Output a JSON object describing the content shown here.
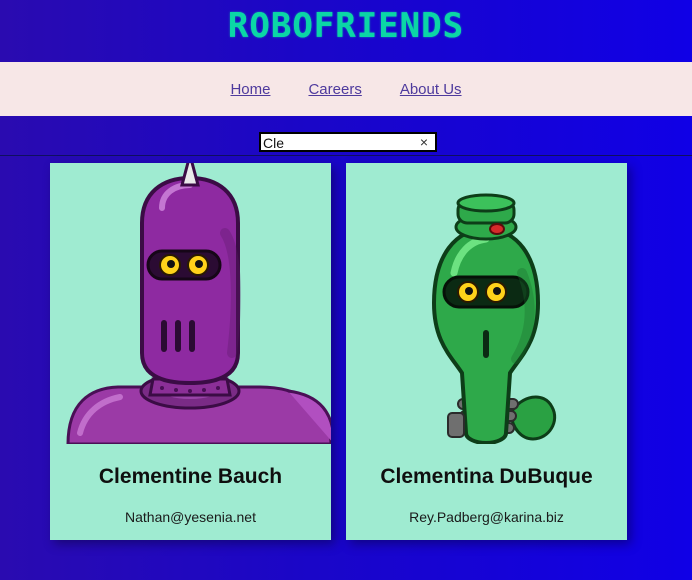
{
  "app": {
    "title": "ROBOFRIENDS"
  },
  "nav": {
    "items": [
      {
        "label": "Home"
      },
      {
        "label": "Careers"
      },
      {
        "label": "About Us"
      }
    ]
  },
  "search": {
    "value": "Cle",
    "clear_icon": "×"
  },
  "cards": [
    {
      "name": "Clementine Bauch",
      "email": "Nathan@yesenia.net",
      "avatar": {
        "type": "robot-avatar",
        "color": "#7d2a8c"
      }
    },
    {
      "name": "Clementina DuBuque",
      "email": "Rey.Padberg@karina.biz",
      "avatar": {
        "type": "robot-avatar",
        "color": "#2a9e3b"
      }
    }
  ]
}
